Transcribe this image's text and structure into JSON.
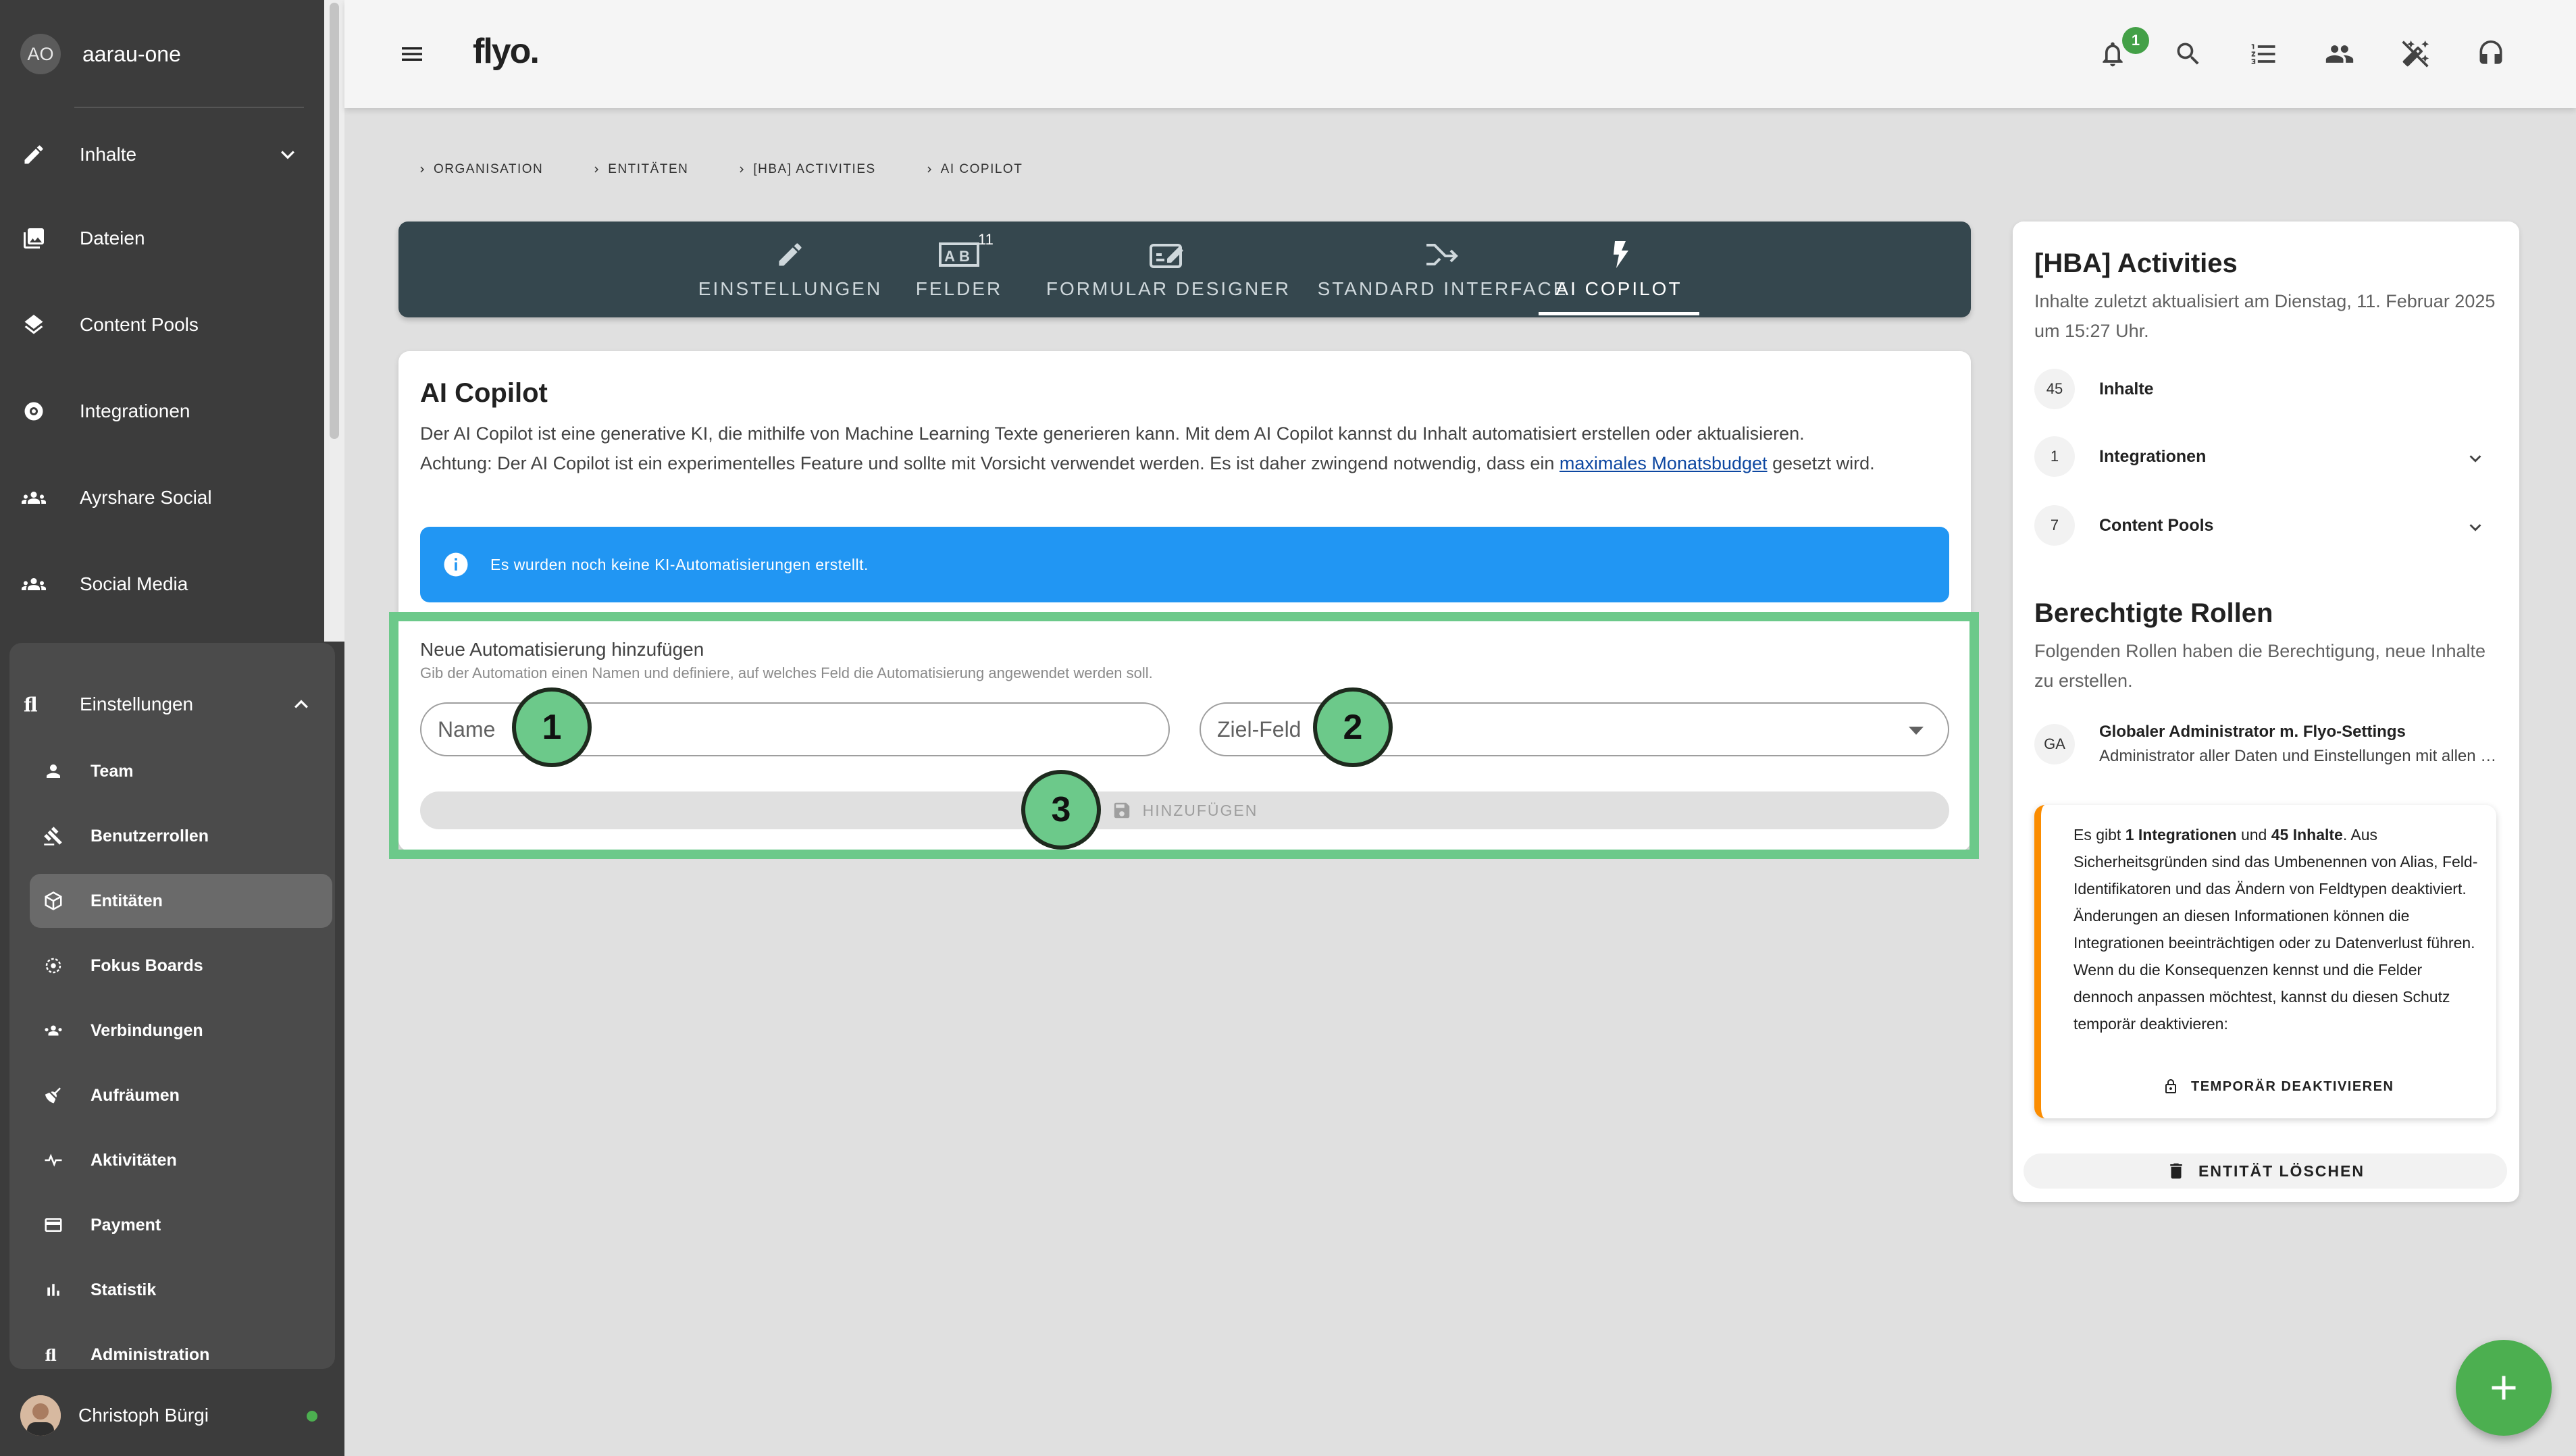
{
  "sidebar": {
    "org": {
      "initials": "AO",
      "name": "aarau-one"
    },
    "items": [
      {
        "label": "Inhalte",
        "icon": "pencil-icon"
      },
      {
        "label": "Dateien",
        "icon": "photo-library-icon"
      },
      {
        "label": "Content Pools",
        "icon": "layers-icon"
      },
      {
        "label": "Integrationen",
        "icon": "integration-icon"
      },
      {
        "label": "Ayrshare Social",
        "icon": "people-icon"
      },
      {
        "label": "Social Media",
        "icon": "people-icon"
      }
    ],
    "settings": {
      "label": "Einstellungen",
      "items": [
        {
          "label": "Team",
          "icon": "person-icon"
        },
        {
          "label": "Benutzerrollen",
          "icon": "gavel-icon"
        },
        {
          "label": "Entitäten",
          "icon": "cube-icon",
          "active": true
        },
        {
          "label": "Fokus Boards",
          "icon": "focus-icon"
        },
        {
          "label": "Verbindungen",
          "icon": "people-icon"
        },
        {
          "label": "Aufräumen",
          "icon": "broom-icon"
        },
        {
          "label": "Aktivitäten",
          "icon": "pulse-icon"
        },
        {
          "label": "Payment",
          "icon": "credit-card-icon"
        },
        {
          "label": "Statistik",
          "icon": "bar-chart-icon"
        },
        {
          "label": "Administration",
          "icon": "flyo-logo-icon"
        }
      ]
    },
    "user": {
      "name": "Christoph Bürgi",
      "status_color": "#4caf50"
    }
  },
  "topbar": {
    "logo": "flyo.",
    "notification_count": "1",
    "icons": [
      "bell-icon",
      "search-icon",
      "checklist-icon",
      "group-icon",
      "magic-off-icon",
      "headset-icon"
    ]
  },
  "breadcrumb": [
    "Organisation",
    "Entitäten",
    "[HBA] Activities",
    "AI Copilot"
  ],
  "tabs": {
    "items": [
      {
        "label": "Einstellungen",
        "icon": "pencil-icon"
      },
      {
        "label": "Felder",
        "icon": "ab-field-icon",
        "count": "11"
      },
      {
        "label": "Formular Designer",
        "icon": "form-edit-icon"
      },
      {
        "label": "Standard Interface",
        "icon": "merge-arrow-icon"
      },
      {
        "label": "AI Copilot",
        "icon": "lightning-icon",
        "active": true
      }
    ]
  },
  "copilot": {
    "title": "AI Copilot",
    "desc_1": "Der AI Copilot ist eine generative KI, die mithilfe von Machine Learning Texte generieren kann. Mit dem AI Copilot kannst du Inhalt automatisiert erstellen oder aktualisieren.",
    "desc_2_pre": "Achtung: Der AI Copilot ist ein experimentelles Feature und sollte mit Vorsicht verwendet werden. Es ist daher zwingend notwendig, dass ein ",
    "desc_2_link": "maximales Monatsbudget",
    "desc_2_post": " gesetzt wird.",
    "info": "Es wurden noch keine KI-Automatisierungen erstellt."
  },
  "new_automation": {
    "title": "Neue Automatisierung hinzufügen",
    "subtitle": "Gib der Automation einen Namen und definiere, auf welches Feld die Automatisierung angewendet werden soll.",
    "name_placeholder": "Name",
    "target_label": "Ziel-Feld",
    "add_label": "Hinzufügen"
  },
  "markers": [
    "1",
    "2",
    "3"
  ],
  "entity": {
    "title": "[HBA] Activities",
    "updated": "Inhalte zuletzt aktualisiert am Dienstag, 11. Februar 2025 um 15:27 Uhr.",
    "stats": [
      {
        "count": "45",
        "label": "Inhalte"
      },
      {
        "count": "1",
        "label": "Integrationen"
      },
      {
        "count": "7",
        "label": "Content Pools"
      }
    ],
    "roles_title": "Berechtigte Rollen",
    "roles_sub": "Folgenden Rollen haben die Berechtigung, neue Inhalte zu erstellen.",
    "role": {
      "initials": "GA",
      "name": "Globaler Administrator m. Flyo-Settings",
      "desc": "Administrator aller Daten und Einstellungen mit allen Berechtigungen"
    },
    "warning": {
      "pre": "Es gibt ",
      "integrations": "1 Integrationen",
      "mid": " und ",
      "contents": "45 Inhalte",
      "post": ". Aus Sicherheitsgründen sind das Umbenennen von Alias, Feld-Identifikatoren und das Ändern von Feldtypen deaktiviert. Änderungen an diesen Informationen können die Integrationen beeinträchtigen oder zu Datenverlust führen. Wenn du die Konsequenzen kennst und die Felder dennoch anpassen möchtest, kannst du diesen Schutz temporär deaktivieren:",
      "button": "Temporär deaktivieren"
    },
    "delete_label": "Entität löschen"
  },
  "colors": {
    "accent": "#2196f3",
    "highlight": "#6cc98a",
    "tabbar": "#35474e",
    "warning": "#fb8c00",
    "fab": "#4caf50"
  }
}
